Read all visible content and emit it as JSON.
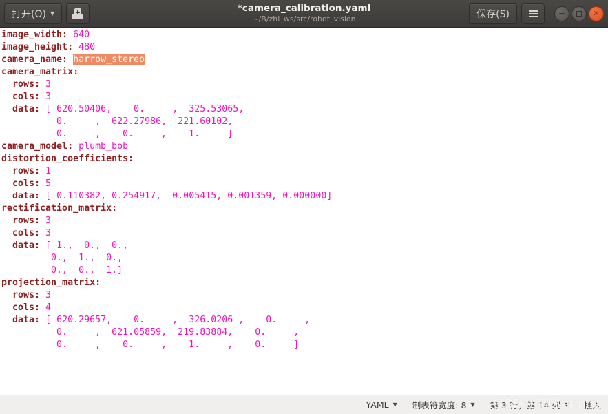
{
  "titlebar": {
    "open_button": "打开(O)",
    "open_caret": "▼",
    "saveas_icon": "document-save-as-icon",
    "title": "*camera_calibration.yaml",
    "subtitle": "~/B/zhl_ws/src/robot_vision",
    "save_button": "保存(S)",
    "menu_icon": "hamburger-menu-icon",
    "minimize": "−",
    "maximize": "□",
    "close": "✕"
  },
  "editor": {
    "lines": [
      {
        "key": "image_width:",
        "value": " 640"
      },
      {
        "key": "image_height:",
        "value": " 480"
      },
      {
        "key": "camera_name:",
        "value": " harrow_stereo",
        "selected_value": "harrow_stereo"
      },
      {
        "key": "camera_matrix:",
        "value": ""
      },
      {
        "key": "  rows:",
        "value": " 3"
      },
      {
        "key": "  cols:",
        "value": " 3"
      },
      {
        "key": "  data:",
        "value": " [ 620.50406,    0.     ,  325.53065,"
      },
      {
        "key": "",
        "value": "          0.     ,  622.27986,  221.60102,"
      },
      {
        "key": "",
        "value": "          0.     ,    0.     ,    1.     ]"
      },
      {
        "key": "camera_model:",
        "value": " plumb_bob"
      },
      {
        "key": "distortion_coefficients:",
        "value": ""
      },
      {
        "key": "  rows:",
        "value": " 1"
      },
      {
        "key": "  cols:",
        "value": " 5"
      },
      {
        "key": "  data:",
        "value": " [-0.110382, 0.254917, -0.005415, 0.001359, 0.000000]"
      },
      {
        "key": "rectification_matrix:",
        "value": ""
      },
      {
        "key": "  rows:",
        "value": " 3"
      },
      {
        "key": "  cols:",
        "value": " 3"
      },
      {
        "key": "  data:",
        "value": " [ 1.,  0.,  0.,"
      },
      {
        "key": "",
        "value": "         0.,  1.,  0.,"
      },
      {
        "key": "",
        "value": "         0.,  0.,  1.]"
      },
      {
        "key": "projection_matrix:",
        "value": ""
      },
      {
        "key": "  rows:",
        "value": " 3"
      },
      {
        "key": "  cols:",
        "value": " 4"
      },
      {
        "key": "  data:",
        "value": " [ 620.29657,    0.     ,  326.0206 ,    0.     ,"
      },
      {
        "key": "",
        "value": "          0.     ,  621.05859,  219.83884,    0.     ,"
      },
      {
        "key": "",
        "value": "          0.     ,    0.     ,    1.     ,    0.     ]"
      }
    ],
    "raw_text": "image_width: 640\nimage_height: 480\ncamera_name: harrow_stereo\ncamera_matrix:\n  rows: 3\n  cols: 3\n  data: [ 620.50406,    0.     ,  325.53065,\n          0.     ,  622.27986,  221.60102,\n          0.     ,    0.     ,    1.     ]\ncamera_model: plumb_bob\ndistortion_coefficients:\n  rows: 1\n  cols: 5\n  data: [-0.110382, 0.254917, -0.005415, 0.001359, 0.000000]\nrectification_matrix:\n  rows: 3\n  cols: 3\n  data: [ 1.,  0.,  0.,\n         0.,  1.,  0.,\n         0.,  0.,  1.]\nprojection_matrix:\n  rows: 3\n  cols: 4\n  data: [ 620.29657,    0.     ,  326.0206 ,    0.     ,\n          0.     ,  621.05859,  219.83884,    0.     ,\n          0.     ,    0.     ,    1.     ,    0.     ]"
  },
  "statusbar": {
    "language": "YAML",
    "language_caret": "▼",
    "tab_width": "制表符宽度: 8",
    "tab_width_caret": "▼",
    "cursor_position": "第 3 行，第 14 列",
    "cursor_caret": "▼",
    "insert_mode": "插入",
    "watermark": "CSDN @Serinus"
  },
  "colors": {
    "key": "#8f2121",
    "value": "#f012be",
    "selection": "#f08a63",
    "titlebar": "#45433f",
    "statusbar": "#f1efee",
    "close_button": "#db4a20"
  }
}
